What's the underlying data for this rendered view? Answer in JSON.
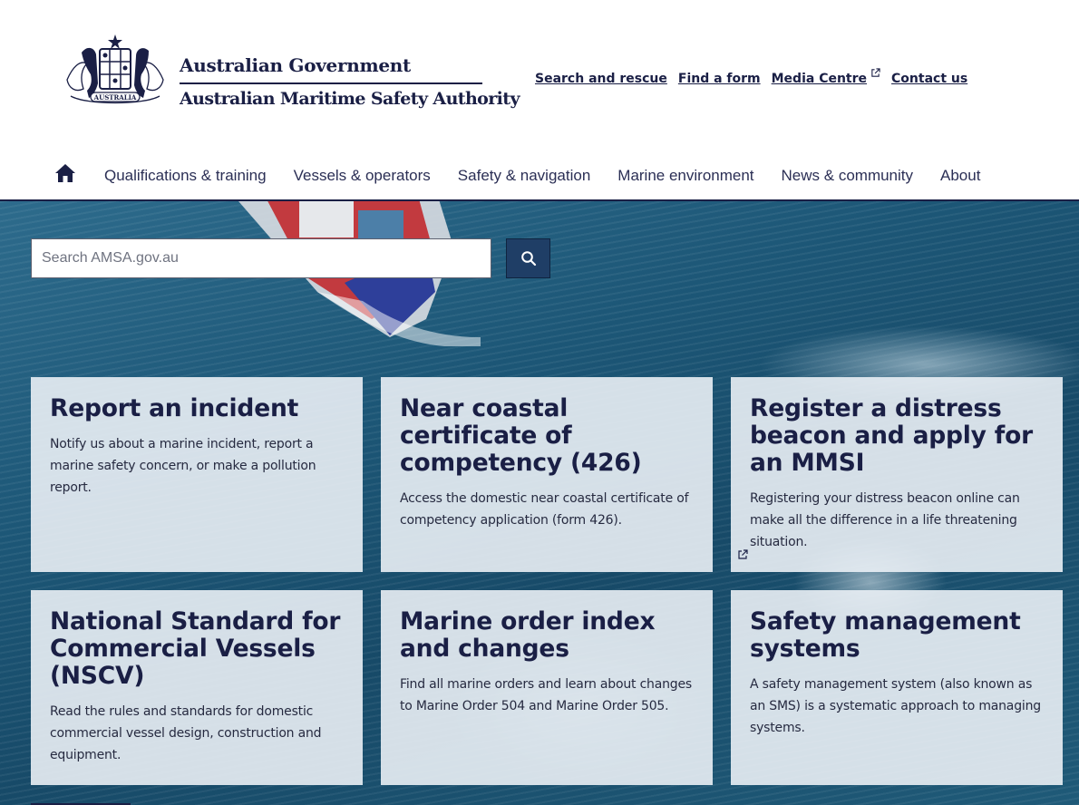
{
  "header": {
    "government": "Australian Government",
    "agency": "Australian Maritime Safety Authority",
    "crest_text": "AUSTRALIA",
    "utility_links": [
      {
        "label": "Search and rescue"
      },
      {
        "label": "Find a form"
      },
      {
        "label": "Media Centre",
        "external": true
      },
      {
        "label": "Contact us"
      }
    ]
  },
  "nav": {
    "home_icon": "home-icon",
    "items": [
      "Qualifications & training",
      "Vessels & operators",
      "Safety & navigation",
      "Marine environment",
      "News & community",
      "About"
    ]
  },
  "search": {
    "placeholder": "Search AMSA.gov.au",
    "button_icon": "search-icon"
  },
  "cards": [
    {
      "title": "Report an incident",
      "text": "Notify us about a marine incident, report a marine safety concern, or make a pollution report."
    },
    {
      "title": "Near coastal certificate of competency (426)",
      "text": "Access the domestic near coastal certificate of competency application (form 426)."
    },
    {
      "title": "Register a distress beacon and apply for an MMSI",
      "text": "Registering your distress beacon online can make all the difference in a life threatening situation.",
      "external": true
    },
    {
      "title": "National Standard for Commercial Vessels (NSCV)",
      "text": "Read the rules and standards for domestic commercial vessel design, construction and equipment."
    },
    {
      "title": "Marine order index and changes",
      "text": "Find all marine orders and learn about changes to Marine Order 504 and Marine Order 505."
    },
    {
      "title": "Safety management systems",
      "text": "A safety management system (also known as an SMS) is a systematic approach to managing systems."
    }
  ],
  "colors": {
    "navy": "#1a1f45",
    "search_button": "#1f3e66",
    "card_bg": "#eaf0f5"
  }
}
